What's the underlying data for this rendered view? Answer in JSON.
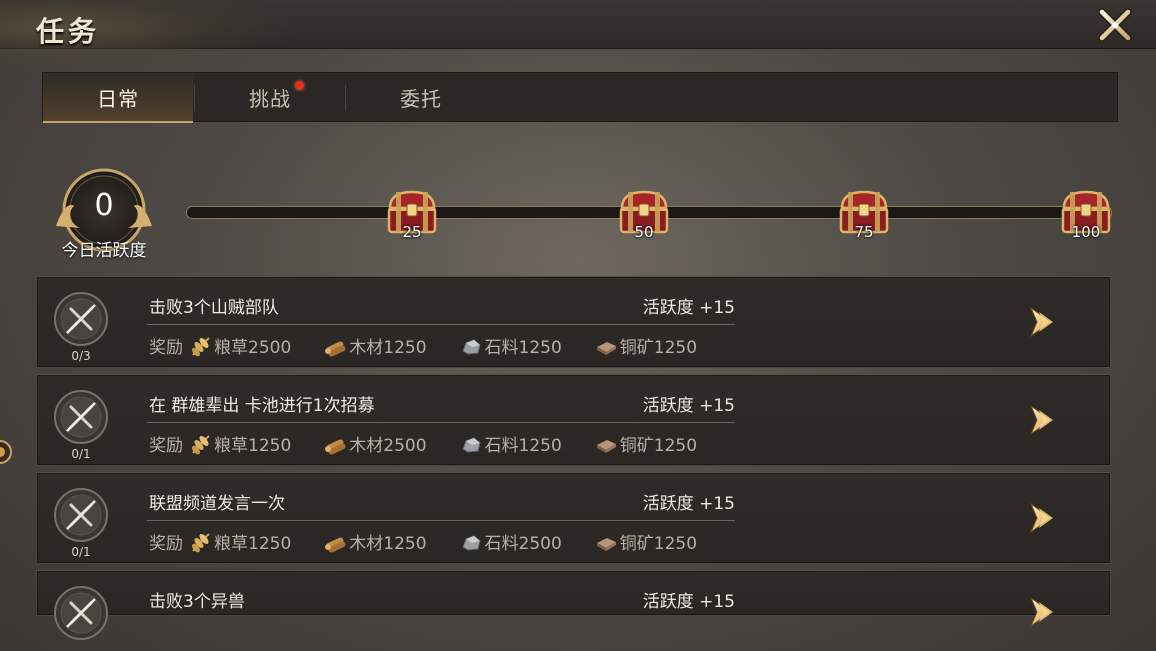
{
  "header": {
    "title": "任务",
    "close_icon": "close-x-icon"
  },
  "tabs": [
    {
      "label": "日常",
      "active": true,
      "badge": false
    },
    {
      "label": "挑战",
      "active": false,
      "badge": true
    },
    {
      "label": "委托",
      "active": false,
      "badge": false
    }
  ],
  "activity": {
    "value": "0",
    "label": "今日活跃度",
    "progress_fraction": 0,
    "milestones": [
      {
        "value": "25",
        "icon": "treasure-chest-icon"
      },
      {
        "value": "50",
        "icon": "treasure-chest-icon"
      },
      {
        "value": "75",
        "icon": "treasure-chest-icon"
      },
      {
        "value": "100",
        "icon": "treasure-chest-icon"
      }
    ]
  },
  "tasks": [
    {
      "title": "击败3个山贼部队",
      "points": "活跃度 +15",
      "count": "0/3",
      "reward_label": "奖励",
      "rewards": [
        {
          "icon": "grain-icon",
          "text": "粮草2500"
        },
        {
          "icon": "wood-icon",
          "text": "木材1250"
        },
        {
          "icon": "stone-icon",
          "text": "石料1250"
        },
        {
          "icon": "copper-ore-icon",
          "text": "铜矿1250"
        }
      ]
    },
    {
      "title": "在 群雄辈出 卡池进行1次招募",
      "points": "活跃度 +15",
      "count": "0/1",
      "reward_label": "奖励",
      "rewards": [
        {
          "icon": "grain-icon",
          "text": "粮草1250"
        },
        {
          "icon": "wood-icon",
          "text": "木材2500"
        },
        {
          "icon": "stone-icon",
          "text": "石料1250"
        },
        {
          "icon": "copper-ore-icon",
          "text": "铜矿1250"
        }
      ]
    },
    {
      "title": "联盟频道发言一次",
      "points": "活跃度 +15",
      "count": "0/1",
      "reward_label": "奖励",
      "rewards": [
        {
          "icon": "grain-icon",
          "text": "粮草1250"
        },
        {
          "icon": "wood-icon",
          "text": "木材1250"
        },
        {
          "icon": "stone-icon",
          "text": "石料2500"
        },
        {
          "icon": "copper-ore-icon",
          "text": "铜矿1250"
        }
      ]
    },
    {
      "title": "击败3个异兽",
      "points": "活跃度 +15"
    }
  ],
  "colors": {
    "accent_gold": "#d2b070",
    "badge_red": "#e0301e",
    "panel_bg": "#2d2927"
  }
}
